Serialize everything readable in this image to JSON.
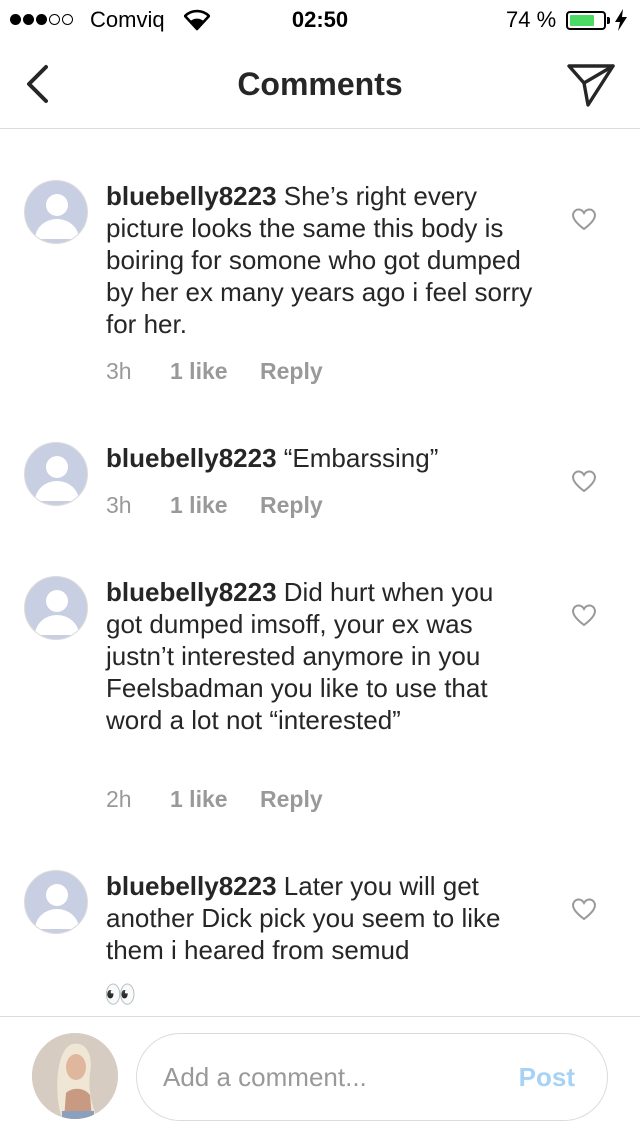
{
  "status_bar": {
    "carrier": "Comviq",
    "time": "02:50",
    "battery_text": "74 %",
    "battery_level": 0.74,
    "signal_bars_filled": 3,
    "signal_bars_total": 5
  },
  "nav": {
    "title": "Comments",
    "back_icon": "chevron-left-icon",
    "send_icon": "paper-plane-icon"
  },
  "comments": [
    {
      "username": "bluebelly8223",
      "text": " She’s right every picture looks the same this body is boiring for somone who got dumped by her ex many years ago i feel sorry for her.",
      "time": "3h",
      "likes": "1 like",
      "reply": "Reply"
    },
    {
      "username": "bluebelly8223",
      "text": " “Embarssing”",
      "time": "3h",
      "likes": "1 like",
      "reply": "Reply"
    },
    {
      "username": "bluebelly8223",
      "text": " Did hurt when you got dumped imsoff, your ex was justn’t interested anymore in you Feelsbadman you like to use that word a lot not “interested”",
      "time": "2h",
      "likes": "1 like",
      "reply": "Reply"
    },
    {
      "username": "bluebelly8223",
      "text": " Later you will get another Dick pick you seem to like them i heared from semud",
      "emoji": "👀"
    }
  ],
  "input": {
    "placeholder": "Add a comment...",
    "post_label": "Post"
  },
  "colors": {
    "text": "#262626",
    "meta": "#999999",
    "divider": "#dbdbdb",
    "post_disabled": "#a8d2f5",
    "battery": "#4cd964",
    "avatar_placeholder": "#c9cfe2"
  }
}
